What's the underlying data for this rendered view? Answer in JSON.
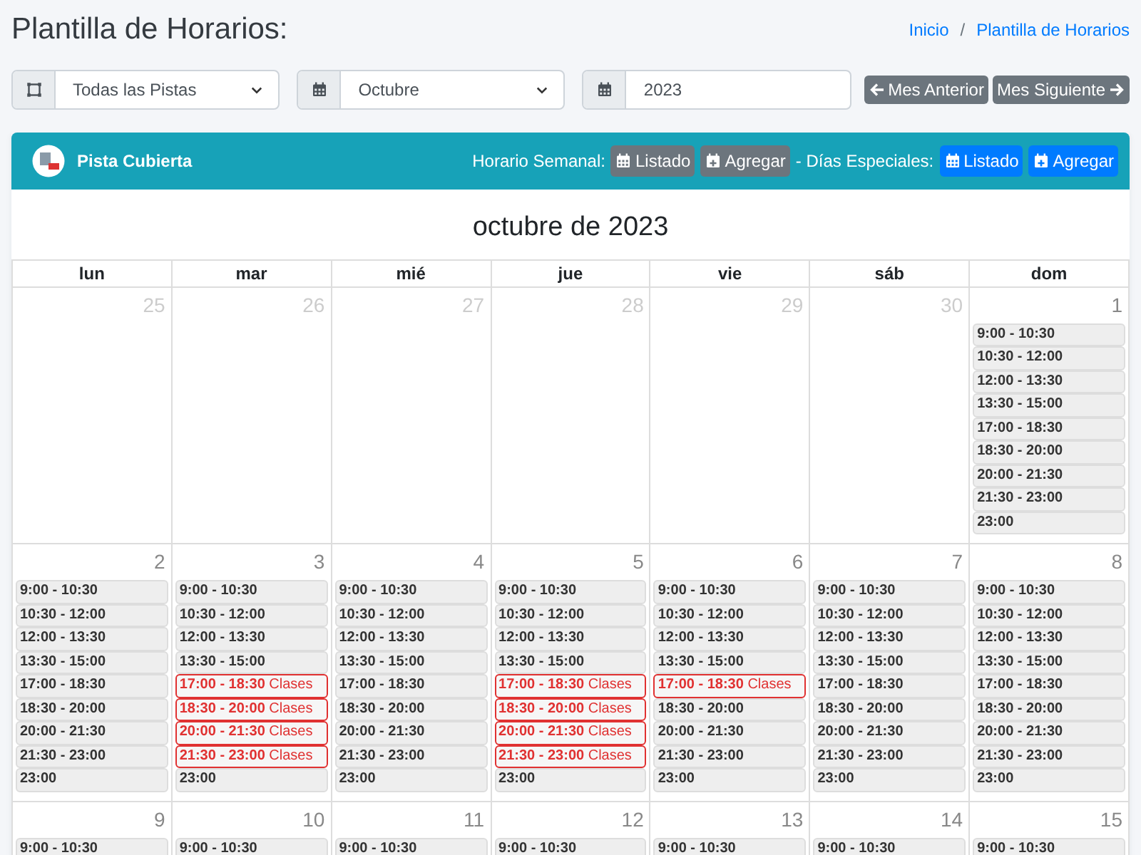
{
  "page": {
    "title": "Plantilla de Horarios:"
  },
  "breadcrumb": {
    "items": [
      "Inicio",
      "Plantilla de Horarios"
    ],
    "separator": "/"
  },
  "filters": [
    {
      "kind": "court",
      "value": "Todas las Pistas"
    },
    {
      "kind": "month",
      "value": "Octubre"
    },
    {
      "kind": "year",
      "value": "2023"
    }
  ],
  "nav_buttons": [
    {
      "label": "Mes Anterior",
      "kind": "prev"
    },
    {
      "label": "Mes Siguiente",
      "kind": "next"
    }
  ],
  "card": {
    "title": "Pista Cubierta",
    "weekly_label": "Horario Semanal:",
    "weekly_buttons": [
      {
        "label": "Listado",
        "kind": "list"
      },
      {
        "label": "Agregar",
        "kind": "add"
      }
    ],
    "special_label": "- Días Especiales:",
    "special_buttons": [
      {
        "label": "Listado",
        "kind": "list"
      },
      {
        "label": "Agregar",
        "kind": "add"
      }
    ]
  },
  "calendar": {
    "title": "octubre de 2023",
    "weekdays": [
      "lun",
      "mar",
      "mié",
      "jue",
      "vie",
      "sáb",
      "dom"
    ],
    "weeks": [
      [
        {
          "day": "25",
          "other_month": true
        },
        {
          "day": "26",
          "other_month": true
        },
        {
          "day": "27",
          "other_month": true
        },
        {
          "day": "28",
          "other_month": true
        },
        {
          "day": "29",
          "other_month": true
        },
        {
          "day": "30",
          "other_month": true
        },
        {
          "day": "1",
          "other_month": false,
          "slots": [
            {
              "time": "9:00 - 10:30",
              "booked": false
            },
            {
              "time": "10:30 - 12:00",
              "booked": false
            },
            {
              "time": "12:00 - 13:30",
              "booked": false
            },
            {
              "time": "13:30 - 15:00",
              "booked": false
            },
            {
              "time": "17:00 - 18:30",
              "booked": false
            },
            {
              "time": "18:30 - 20:00",
              "booked": false
            },
            {
              "time": "20:00 - 21:30",
              "booked": false
            },
            {
              "time": "21:30 - 23:00",
              "booked": false
            },
            {
              "time": "23:00",
              "booked": false
            }
          ]
        }
      ],
      [
        {
          "day": "2",
          "other_month": false,
          "slots": [
            {
              "time": "9:00 - 10:30",
              "booked": false
            },
            {
              "time": "10:30 - 12:00",
              "booked": false
            },
            {
              "time": "12:00 - 13:30",
              "booked": false
            },
            {
              "time": "13:30 - 15:00",
              "booked": false
            },
            {
              "time": "17:00 - 18:30",
              "booked": false
            },
            {
              "time": "18:30 - 20:00",
              "booked": false
            },
            {
              "time": "20:00 - 21:30",
              "booked": false
            },
            {
              "time": "21:30 - 23:00",
              "booked": false
            },
            {
              "time": "23:00",
              "booked": false
            }
          ]
        },
        {
          "day": "3",
          "other_month": false,
          "slots": [
            {
              "time": "9:00 - 10:30",
              "booked": false
            },
            {
              "time": "10:30 - 12:00",
              "booked": false
            },
            {
              "time": "12:00 - 13:30",
              "booked": false
            },
            {
              "time": "13:30 - 15:00",
              "booked": false
            },
            {
              "time": "17:00 - 18:30",
              "booked": true,
              "note": "Clases"
            },
            {
              "time": "18:30 - 20:00",
              "booked": true,
              "note": "Clases"
            },
            {
              "time": "20:00 - 21:30",
              "booked": true,
              "note": "Clases"
            },
            {
              "time": "21:30 - 23:00",
              "booked": true,
              "note": "Clases"
            },
            {
              "time": "23:00",
              "booked": false
            }
          ]
        },
        {
          "day": "4",
          "other_month": false,
          "slots": [
            {
              "time": "9:00 - 10:30",
              "booked": false
            },
            {
              "time": "10:30 - 12:00",
              "booked": false
            },
            {
              "time": "12:00 - 13:30",
              "booked": false
            },
            {
              "time": "13:30 - 15:00",
              "booked": false
            },
            {
              "time": "17:00 - 18:30",
              "booked": false
            },
            {
              "time": "18:30 - 20:00",
              "booked": false
            },
            {
              "time": "20:00 - 21:30",
              "booked": false
            },
            {
              "time": "21:30 - 23:00",
              "booked": false
            },
            {
              "time": "23:00",
              "booked": false
            }
          ]
        },
        {
          "day": "5",
          "other_month": false,
          "slots": [
            {
              "time": "9:00 - 10:30",
              "booked": false
            },
            {
              "time": "10:30 - 12:00",
              "booked": false
            },
            {
              "time": "12:00 - 13:30",
              "booked": false
            },
            {
              "time": "13:30 - 15:00",
              "booked": false
            },
            {
              "time": "17:00 - 18:30",
              "booked": true,
              "note": "Clases"
            },
            {
              "time": "18:30 - 20:00",
              "booked": true,
              "note": "Clases"
            },
            {
              "time": "20:00 - 21:30",
              "booked": true,
              "note": "Clases"
            },
            {
              "time": "21:30 - 23:00",
              "booked": true,
              "note": "Clases"
            },
            {
              "time": "23:00",
              "booked": false
            }
          ]
        },
        {
          "day": "6",
          "other_month": false,
          "slots": [
            {
              "time": "9:00 - 10:30",
              "booked": false
            },
            {
              "time": "10:30 - 12:00",
              "booked": false
            },
            {
              "time": "12:00 - 13:30",
              "booked": false
            },
            {
              "time": "13:30 - 15:00",
              "booked": false
            },
            {
              "time": "17:00 - 18:30",
              "booked": true,
              "note": "Clases"
            },
            {
              "time": "18:30 - 20:00",
              "booked": false
            },
            {
              "time": "20:00 - 21:30",
              "booked": false
            },
            {
              "time": "21:30 - 23:00",
              "booked": false
            },
            {
              "time": "23:00",
              "booked": false
            }
          ]
        },
        {
          "day": "7",
          "other_month": false,
          "slots": [
            {
              "time": "9:00 - 10:30",
              "booked": false
            },
            {
              "time": "10:30 - 12:00",
              "booked": false
            },
            {
              "time": "12:00 - 13:30",
              "booked": false
            },
            {
              "time": "13:30 - 15:00",
              "booked": false
            },
            {
              "time": "17:00 - 18:30",
              "booked": false
            },
            {
              "time": "18:30 - 20:00",
              "booked": false
            },
            {
              "time": "20:00 - 21:30",
              "booked": false
            },
            {
              "time": "21:30 - 23:00",
              "booked": false
            },
            {
              "time": "23:00",
              "booked": false
            }
          ]
        },
        {
          "day": "8",
          "other_month": false,
          "slots": [
            {
              "time": "9:00 - 10:30",
              "booked": false
            },
            {
              "time": "10:30 - 12:00",
              "booked": false
            },
            {
              "time": "12:00 - 13:30",
              "booked": false
            },
            {
              "time": "13:30 - 15:00",
              "booked": false
            },
            {
              "time": "17:00 - 18:30",
              "booked": false
            },
            {
              "time": "18:30 - 20:00",
              "booked": false
            },
            {
              "time": "20:00 - 21:30",
              "booked": false
            },
            {
              "time": "21:30 - 23:00",
              "booked": false
            },
            {
              "time": "23:00",
              "booked": false
            }
          ]
        }
      ],
      [
        {
          "day": "9",
          "other_month": false,
          "slots": [
            {
              "time": "9:00 - 10:30",
              "booked": false
            }
          ]
        },
        {
          "day": "10",
          "other_month": false,
          "slots": [
            {
              "time": "9:00 - 10:30",
              "booked": false
            }
          ]
        },
        {
          "day": "11",
          "other_month": false,
          "slots": [
            {
              "time": "9:00 - 10:30",
              "booked": false
            }
          ]
        },
        {
          "day": "12",
          "other_month": false,
          "slots": [
            {
              "time": "9:00 - 10:30",
              "booked": false
            }
          ]
        },
        {
          "day": "13",
          "other_month": false,
          "slots": [
            {
              "time": "9:00 - 10:30",
              "booked": false
            }
          ]
        },
        {
          "day": "14",
          "other_month": false,
          "slots": [
            {
              "time": "9:00 - 10:30",
              "booked": false
            }
          ]
        },
        {
          "day": "15",
          "other_month": false,
          "slots": [
            {
              "time": "9:00 - 10:30",
              "booked": false
            }
          ]
        }
      ]
    ]
  }
}
